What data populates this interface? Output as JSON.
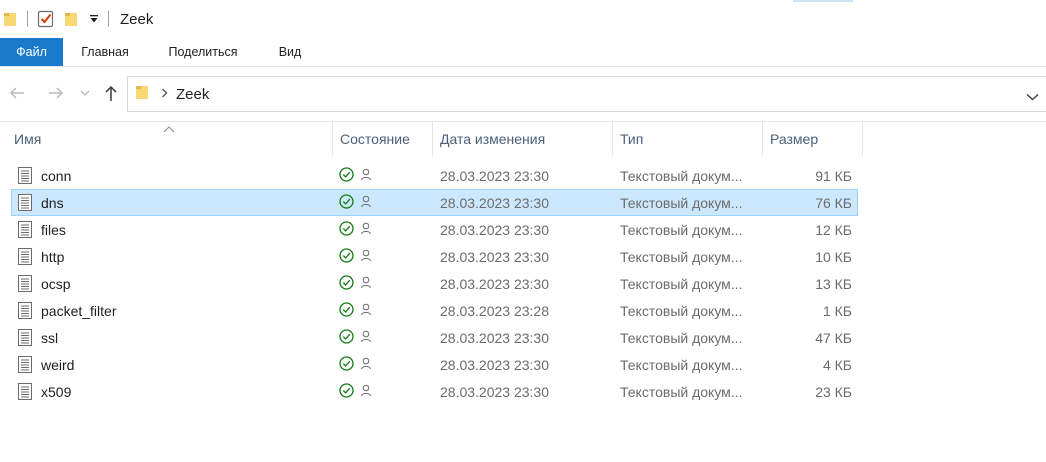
{
  "window": {
    "title": "Zeek"
  },
  "ribbon": {
    "tabs": [
      {
        "label": "Файл"
      },
      {
        "label": "Главная"
      },
      {
        "label": "Поделиться"
      },
      {
        "label": "Вид"
      }
    ]
  },
  "address": {
    "path": "Zeek"
  },
  "columns": [
    {
      "label": "Имя"
    },
    {
      "label": "Состояние"
    },
    {
      "label": "Дата изменения"
    },
    {
      "label": "Тип"
    },
    {
      "label": "Размер"
    }
  ],
  "files": [
    {
      "name": "conn",
      "modified": "28.03.2023 23:30",
      "type": "Текстовый докум...",
      "size": "91 КБ",
      "selected": false
    },
    {
      "name": "dns",
      "modified": "28.03.2023 23:30",
      "type": "Текстовый докум...",
      "size": "76 КБ",
      "selected": true
    },
    {
      "name": "files",
      "modified": "28.03.2023 23:30",
      "type": "Текстовый докум...",
      "size": "12 КБ",
      "selected": false
    },
    {
      "name": "http",
      "modified": "28.03.2023 23:30",
      "type": "Текстовый докум...",
      "size": "10 КБ",
      "selected": false
    },
    {
      "name": "ocsp",
      "modified": "28.03.2023 23:30",
      "type": "Текстовый докум...",
      "size": "13 КБ",
      "selected": false
    },
    {
      "name": "packet_filter",
      "modified": "28.03.2023 23:28",
      "type": "Текстовый докум...",
      "size": "1 КБ",
      "selected": false
    },
    {
      "name": "ssl",
      "modified": "28.03.2023 23:30",
      "type": "Текстовый докум...",
      "size": "47 КБ",
      "selected": false
    },
    {
      "name": "weird",
      "modified": "28.03.2023 23:30",
      "type": "Текстовый докум...",
      "size": "4 КБ",
      "selected": false
    },
    {
      "name": "x509",
      "modified": "28.03.2023 23:30",
      "type": "Текстовый докум...",
      "size": "23 КБ",
      "selected": false
    }
  ],
  "icons": {
    "file": "text-file-icon",
    "status_synced": "sync-ok-icon",
    "status_shared": "person-icon"
  },
  "colors": {
    "accent": "#1979ca",
    "selection": "#cce8ff",
    "selection_border": "#99d1ff",
    "status_green": "#107c10"
  }
}
